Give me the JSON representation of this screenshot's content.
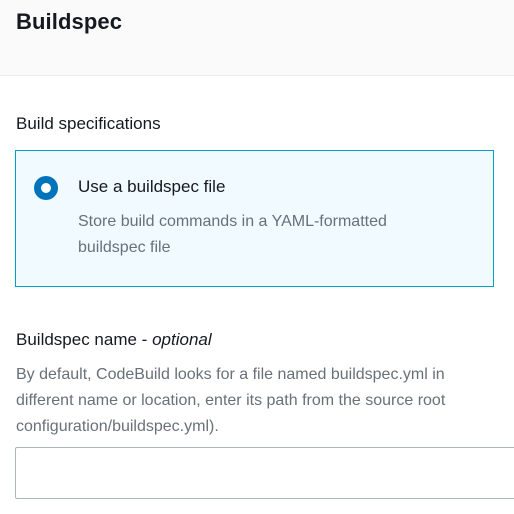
{
  "header": {
    "title": "Buildspec"
  },
  "build_specifications": {
    "label": "Build specifications",
    "option": {
      "selected": true,
      "title": "Use a buildspec file",
      "description_line1": "Store build commands in a YAML-formatted",
      "description_line2": "buildspec file"
    }
  },
  "buildspec_name": {
    "label": "Buildspec name - ",
    "label_optional": "optional",
    "description_line1": "By default, CodeBuild looks for a file named buildspec.yml in",
    "description_line2": "different name or location, enter its path from the source root",
    "description_line3": "configuration/buildspec.yml).",
    "value": "",
    "placeholder": ""
  },
  "colors": {
    "accent": "#0073bb",
    "selected_border": "#00a1c9",
    "selected_background": "#f1faff",
    "secondary_text": "#687078"
  },
  "icons": {
    "radio": "radio-selected-icon"
  }
}
